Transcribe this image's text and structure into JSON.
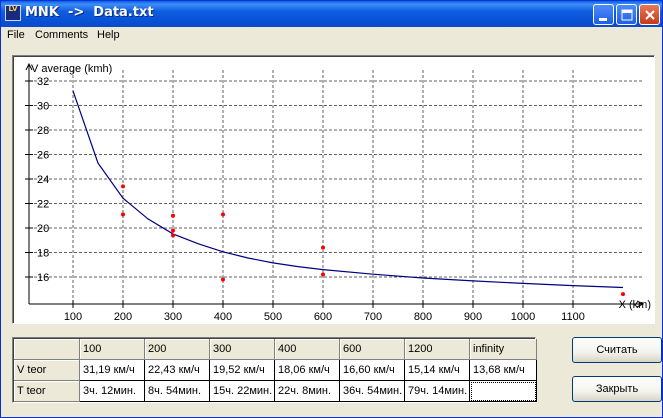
{
  "window": {
    "title": "MNK  ->  Data.txt",
    "icon_text": "LV",
    "icon_name": "app-icon"
  },
  "menu": {
    "items": [
      "File",
      "Comments",
      "Help"
    ]
  },
  "chart_data": {
    "type": "scatter",
    "ylabel": "V average (kmh)",
    "xlabel": "X (km)",
    "x_ticks": [
      100,
      200,
      300,
      400,
      500,
      600,
      700,
      800,
      900,
      1000,
      1100
    ],
    "y_ticks": [
      16,
      18,
      20,
      22,
      24,
      26,
      28,
      30,
      32
    ],
    "xlim": [
      40,
      1160
    ],
    "ylim": [
      14.2,
      32.8
    ],
    "grid": true,
    "points": [
      {
        "x": 200,
        "y": 23.4
      },
      {
        "x": 200,
        "y": 21.1
      },
      {
        "x": 300,
        "y": 21.0
      },
      {
        "x": 300,
        "y": 19.8
      },
      {
        "x": 300,
        "y": 19.4
      },
      {
        "x": 400,
        "y": 21.1
      },
      {
        "x": 400,
        "y": 15.8
      },
      {
        "x": 600,
        "y": 18.4
      },
      {
        "x": 600,
        "y": 16.2
      },
      {
        "x": 1200,
        "y": 14.6
      }
    ],
    "curve": {
      "x": [
        100,
        150,
        200,
        250,
        300,
        350,
        400,
        450,
        500,
        550,
        600,
        700,
        800,
        900,
        1000,
        1100,
        1200
      ],
      "y": [
        31.19,
        25.3,
        22.43,
        20.74,
        19.52,
        18.72,
        18.06,
        17.55,
        17.15,
        16.85,
        16.6,
        16.23,
        15.92,
        15.68,
        15.48,
        15.3,
        15.14
      ]
    },
    "point_color": "#ff0000",
    "curve_color": "#000080"
  },
  "table": {
    "columns": [
      "100",
      "200",
      "300",
      "400",
      "600",
      "1200",
      "infinity"
    ],
    "rows": [
      {
        "label": "V teor",
        "values": [
          "31,19 км/ч",
          "22,43 км/ч",
          "19,52 км/ч",
          "18,06 км/ч",
          "16,60 км/ч",
          "15,14 км/ч",
          "13,68 км/ч"
        ]
      },
      {
        "label": "T teor",
        "values": [
          "3ч. 12мин.",
          "8ч. 54мин.",
          "15ч. 22мин.",
          "22ч. 8мин.",
          "36ч. 54мин.",
          "79ч. 14мин.",
          ""
        ]
      }
    ]
  },
  "buttons": {
    "calculate": "Считать",
    "close": "Закрыть"
  },
  "title_buttons": [
    "minimize-button",
    "maximize-button",
    "close-window-button"
  ]
}
